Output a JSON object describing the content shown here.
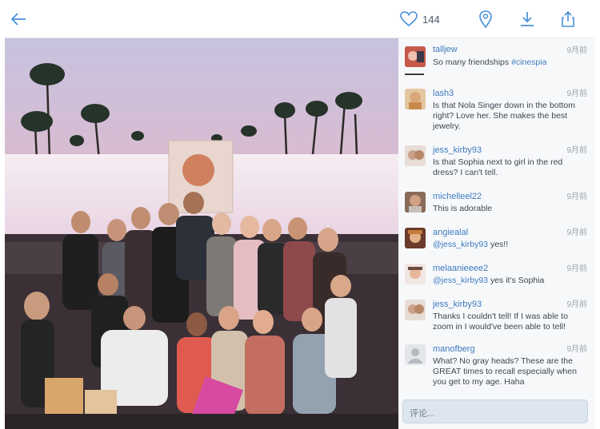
{
  "header": {
    "like_count": "144",
    "icons": [
      "back-arrow-icon",
      "heart-icon",
      "location-pin-icon",
      "download-icon",
      "share-icon"
    ]
  },
  "comments": [
    {
      "user": "talljew",
      "time": "9月前",
      "text_before": "So many friendships ",
      "tag": "#cinespia",
      "text_after": ""
    },
    {
      "user": "lash3",
      "time": "9月前",
      "text_before": "Is that Nola Singer down in the bottom right? Love her. She makes the best jewelry.",
      "tag": "",
      "text_after": ""
    },
    {
      "user": "jess_kirby93",
      "time": "9月前",
      "text_before": "Is that Sophia next to girl in the red dress? I can't tell.",
      "tag": "",
      "text_after": ""
    },
    {
      "user": "michelleel22",
      "time": "9月前",
      "text_before": "This is adorable",
      "tag": "",
      "text_after": ""
    },
    {
      "user": "angiealal",
      "time": "9月前",
      "text_before": "",
      "tag": "@jess_kirby93",
      "text_after": " yes!!"
    },
    {
      "user": "melaanieeee2",
      "time": "9月前",
      "text_before": "",
      "tag": "@jess_kirby93",
      "text_after": " yes it's Sophia"
    },
    {
      "user": "jess_kirby93",
      "time": "9月前",
      "text_before": "Thanks I couldn't tell! If I was able to zoom in I would've been able to tell!",
      "tag": "",
      "text_after": ""
    },
    {
      "user": "manofberg",
      "time": "9月前",
      "text_before": "What?  No gray heads? These are the GREAT times to recall especially when you get to my age.  Haha",
      "tag": "",
      "text_after": ""
    }
  ],
  "reply": {
    "placeholder": "评论..."
  }
}
